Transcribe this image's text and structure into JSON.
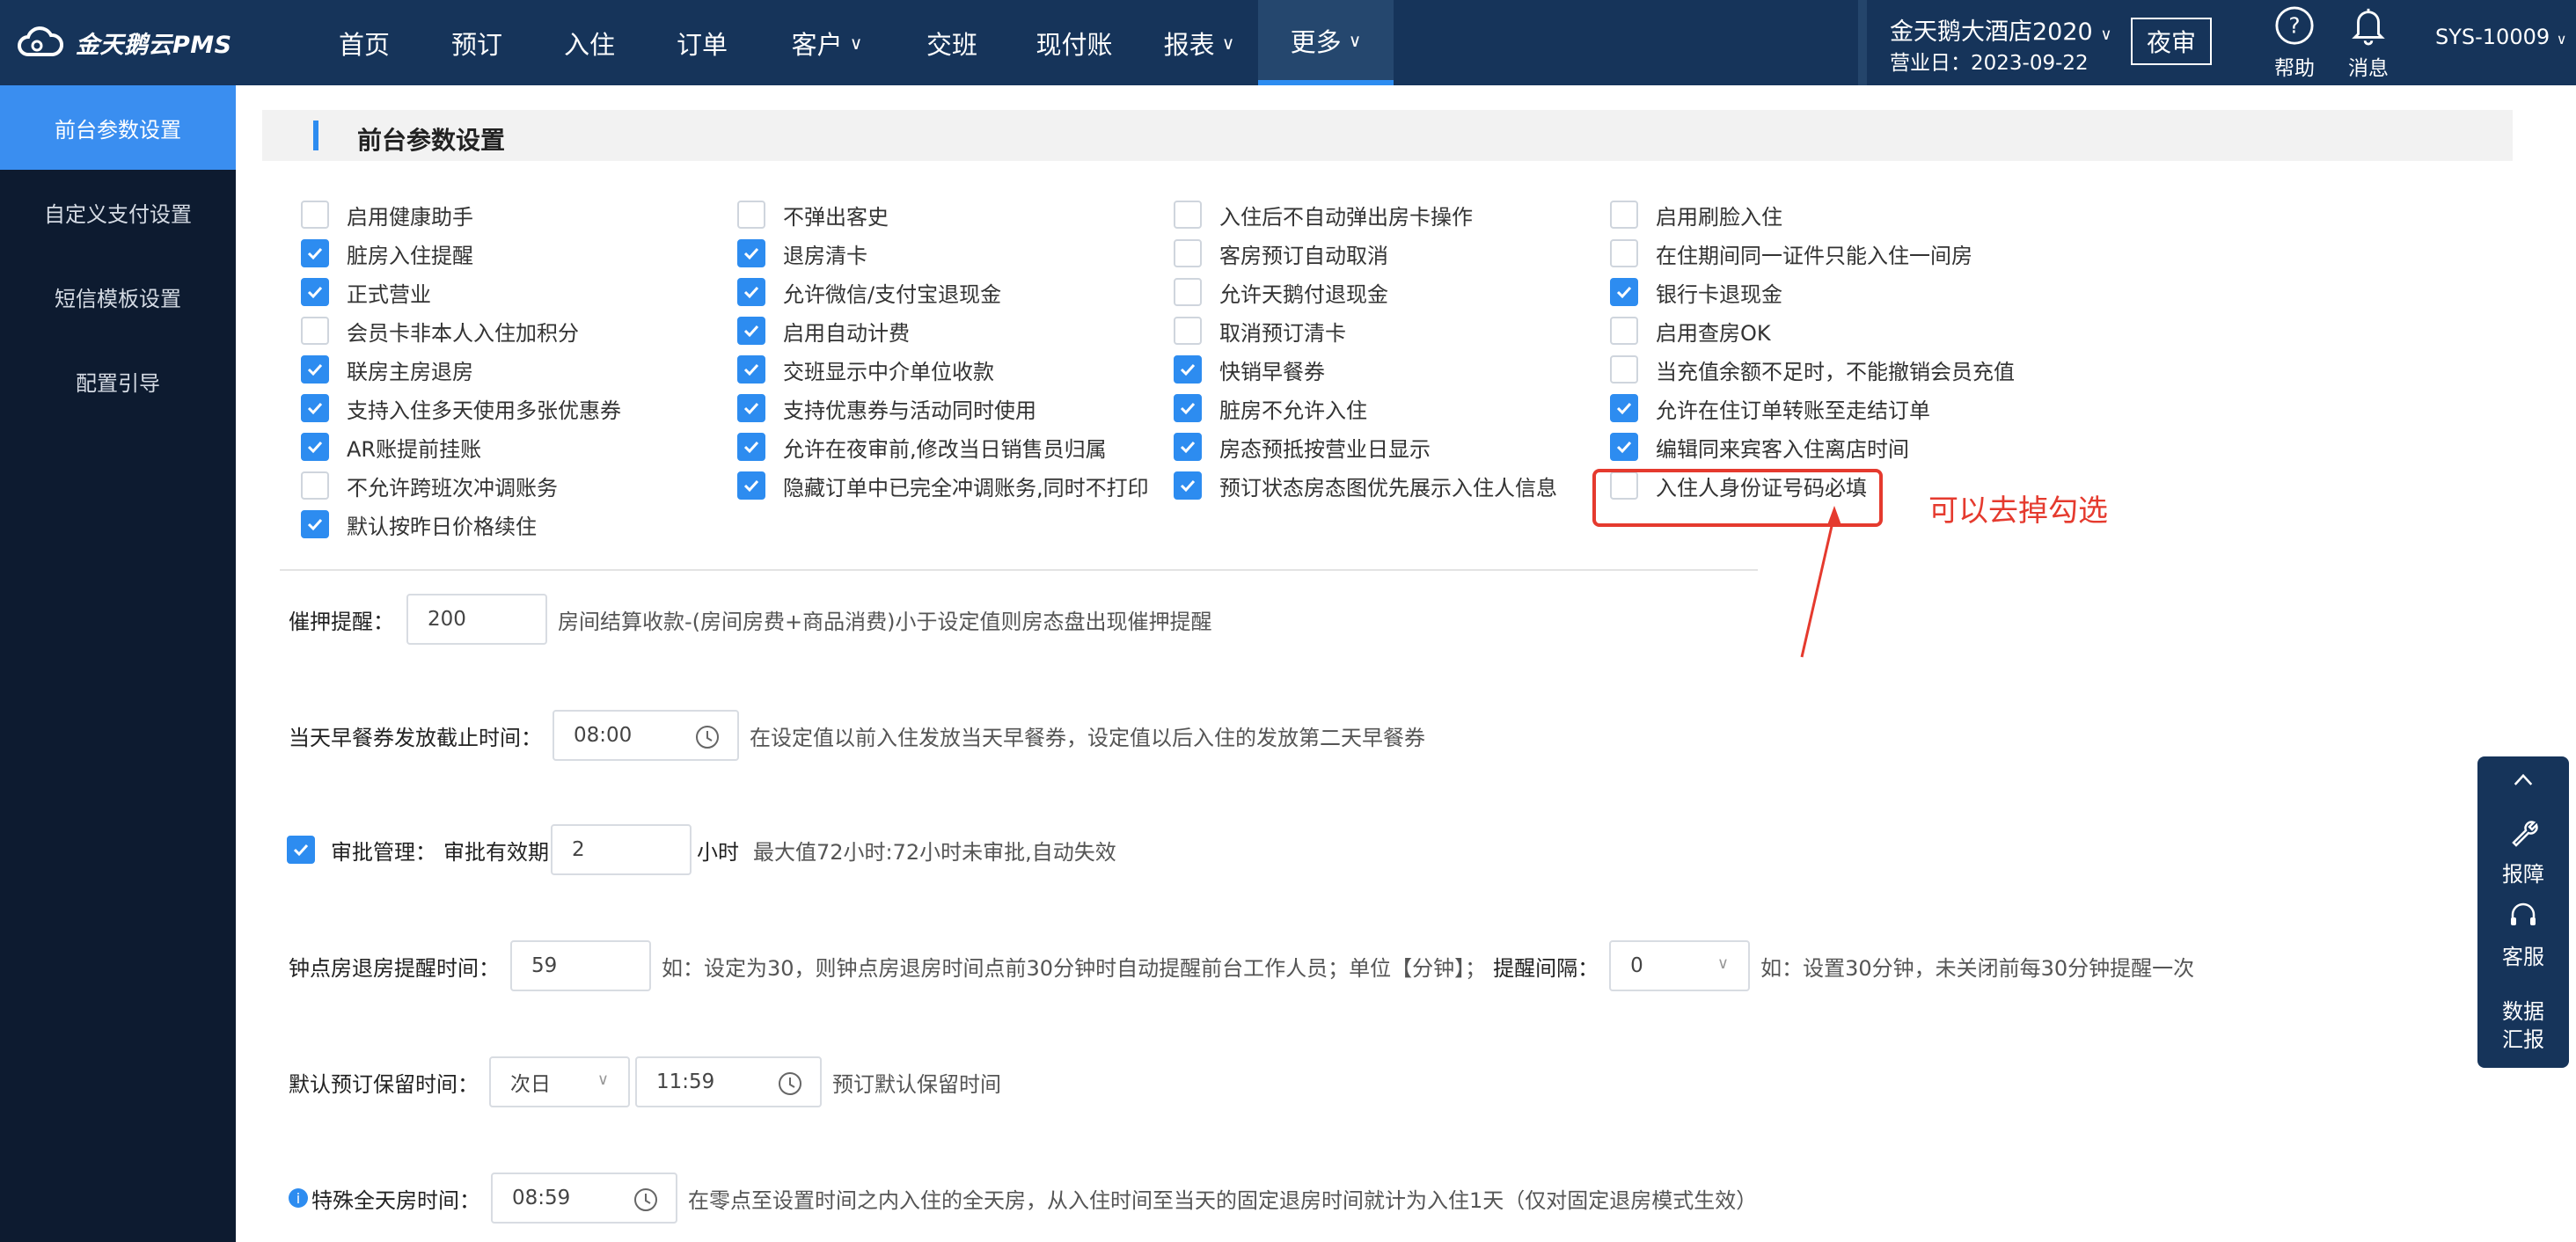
{
  "app": {
    "logo_text": "金天鹅云PMS"
  },
  "nav": [
    {
      "label": "首页",
      "chevron": false,
      "active": false
    },
    {
      "label": "预订",
      "chevron": false,
      "active": false
    },
    {
      "label": "入住",
      "chevron": false,
      "active": false
    },
    {
      "label": "订单",
      "chevron": false,
      "active": false
    },
    {
      "label": "客户",
      "chevron": true,
      "active": false
    },
    {
      "label": "交班",
      "chevron": false,
      "active": false
    },
    {
      "label": "现付账",
      "chevron": false,
      "active": false
    },
    {
      "label": "报表",
      "chevron": true,
      "active": false
    },
    {
      "label": "更多",
      "chevron": true,
      "active": true
    }
  ],
  "header": {
    "hotel_name": "金天鹅大酒店2020",
    "business_date": "营业日：2023-09-22",
    "night_audit": "夜审",
    "help": "帮助",
    "messages": "消息",
    "user": "SYS-10009"
  },
  "sidebar": {
    "items": [
      {
        "label": "前台参数设置",
        "active": true
      },
      {
        "label": "自定义支付设置",
        "active": false
      },
      {
        "label": "短信模板设置",
        "active": false
      },
      {
        "label": "配置引导",
        "active": false
      }
    ]
  },
  "section": {
    "title": "前台参数设置"
  },
  "checkboxes": [
    [
      {
        "label": "启用健康助手",
        "checked": false
      },
      {
        "label": "脏房入住提醒",
        "checked": true
      },
      {
        "label": "正式营业",
        "checked": true
      },
      {
        "label": "会员卡非本人入住加积分",
        "checked": false
      },
      {
        "label": "联房主房退房",
        "checked": true
      },
      {
        "label": "支持入住多天使用多张优惠券",
        "checked": true
      },
      {
        "label": "AR账提前挂账",
        "checked": true
      },
      {
        "label": "不允许跨班次冲调账务",
        "checked": false
      },
      {
        "label": "默认按昨日价格续住",
        "checked": true
      }
    ],
    [
      {
        "label": "不弹出客史",
        "checked": false
      },
      {
        "label": "退房清卡",
        "checked": true
      },
      {
        "label": "允许微信/支付宝退现金",
        "checked": true
      },
      {
        "label": "启用自动计费",
        "checked": true
      },
      {
        "label": "交班显示中介单位收款",
        "checked": true
      },
      {
        "label": "支持优惠券与活动同时使用",
        "checked": true
      },
      {
        "label": "允许在夜审前,修改当日销售员归属",
        "checked": true
      },
      {
        "label": "隐藏订单中已完全冲调账务,同时不打印",
        "checked": true
      }
    ],
    [
      {
        "label": "入住后不自动弹出房卡操作",
        "checked": false
      },
      {
        "label": "客房预订自动取消",
        "checked": false
      },
      {
        "label": "允许天鹅付退现金",
        "checked": false
      },
      {
        "label": "取消预订清卡",
        "checked": false
      },
      {
        "label": "快销早餐券",
        "checked": true
      },
      {
        "label": "脏房不允许入住",
        "checked": true
      },
      {
        "label": "房态预抵按营业日显示",
        "checked": true
      },
      {
        "label": "预订状态房态图优先展示入住人信息",
        "checked": true
      }
    ],
    [
      {
        "label": "启用刷脸入住",
        "checked": false
      },
      {
        "label": "在住期间同一证件只能入住一间房",
        "checked": false
      },
      {
        "label": "银行卡退现金",
        "checked": true
      },
      {
        "label": "启用查房OK",
        "checked": false
      },
      {
        "label": "当充值余额不足时，不能撤销会员充值",
        "checked": false
      },
      {
        "label": "允许在住订单转账至走结订单",
        "checked": true
      },
      {
        "label": "编辑同来宾客入住离店时间",
        "checked": true
      },
      {
        "label": "入住人身份证号码必填",
        "checked": false
      }
    ]
  ],
  "annotation": {
    "text": "可以去掉勾选"
  },
  "settings": {
    "deposit": {
      "label": "催押提醒：",
      "value": "200",
      "hint": "房间结算收款-(房间房费+商品消费)小于设定值则房态盘出现催押提醒"
    },
    "breakfast": {
      "label": "当天早餐券发放截止时间：",
      "value": "08:00",
      "hint": "在设定值以前入住发放当天早餐券，设定值以后入住的发放第二天早餐券"
    },
    "approval": {
      "checked": true,
      "label": "审批管理：",
      "sublabel": "审批有效期",
      "value": "2",
      "unit": "小时",
      "hint": "最大值72小时:72小时未审批,自动失效"
    },
    "hourly": {
      "label": "钟点房退房提醒时间：",
      "value": "59",
      "hint": "如：设定为30，则钟点房退房时间点前30分钟时自动提醒前台工作人员；单位【分钟】；",
      "interval_label": "提醒间隔：",
      "interval_value": "0",
      "interval_hint": "如：设置30分钟，未关闭前每30分钟提醒一次"
    },
    "reserve": {
      "label": "默认预订保留时间：",
      "day_value": "次日",
      "time_value": "11:59",
      "hint": "预订默认保留时间"
    },
    "fullday": {
      "label": "特殊全天房时间：",
      "value": "08:59",
      "hint": "在零点至设置时间之内入住的全天房，从入住时间至当天的固定退房时间就计为入住1天（仅对固定退房模式生效）"
    }
  },
  "float_panel": {
    "report": "报障",
    "service": "客服",
    "data": "数据汇报"
  },
  "colors": {
    "topbar": "#16345a",
    "sidebar": "#0d1b30",
    "accent": "#2d8cf0",
    "annotation": "#e53a2e"
  }
}
